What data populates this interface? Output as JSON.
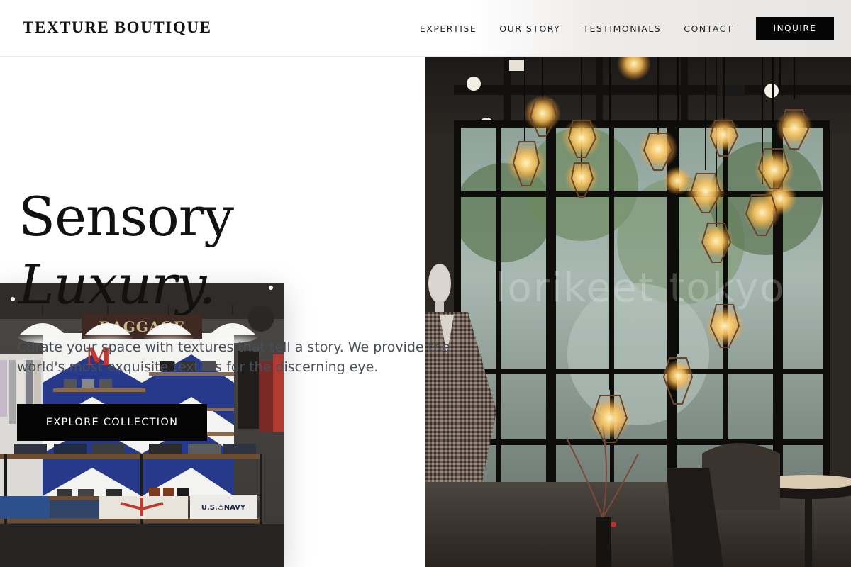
{
  "header": {
    "brand": "TEXTURE BOUTIQUE",
    "nav": [
      {
        "label": "EXPERTISE"
      },
      {
        "label": "OUR STORY"
      },
      {
        "label": "TESTIMONIALS"
      },
      {
        "label": "CONTACT"
      }
    ],
    "cta_label": "INQUIRE"
  },
  "hero": {
    "title_line1": "Sensory",
    "title_line2": "Luxury.",
    "description": "Curate your space with textures that tell a story. We provide the world's most exquisite textiles for the discerning eye.",
    "button_label": "EXPLORE COLLECTION"
  },
  "images": {
    "cafe_sign_text": "lorikeet tokyo",
    "store_sign_text": "BAGGAGE",
    "store_letter": "M",
    "navy_shirt_text": "U.S.⚓NAVY"
  },
  "colors": {
    "primary": "#050505",
    "text": "#111111",
    "body_text": "#4a4f57",
    "background": "#ffffff"
  }
}
